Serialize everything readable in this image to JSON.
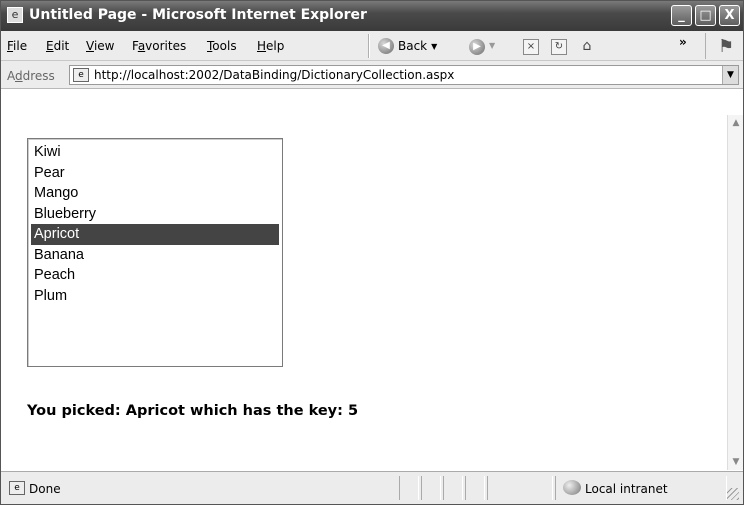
{
  "window": {
    "title": "Untitled Page - Microsoft Internet Explorer",
    "controls": {
      "minimize": "_",
      "maximize": "□",
      "close": "X"
    }
  },
  "menu": {
    "items": [
      {
        "label": "File",
        "accel": "F",
        "rest": "ile"
      },
      {
        "label": "Edit",
        "accel": "E",
        "rest": "dit"
      },
      {
        "label": "View",
        "accel": "V",
        "rest": "iew"
      },
      {
        "label": "Favorites",
        "pre": "F",
        "accel": "a",
        "rest": "vorites"
      },
      {
        "label": "Tools",
        "accel": "T",
        "rest": "ools"
      },
      {
        "label": "Help",
        "accel": "H",
        "rest": "elp"
      }
    ],
    "back_label": "Back",
    "more_chevron": "»"
  },
  "address": {
    "label_pre": "A",
    "label_accel": "d",
    "label_rest": "dress",
    "url": "http://localhost:2002/DataBinding/DictionaryCollection.aspx"
  },
  "listbox": {
    "options": [
      "Kiwi",
      "Pear",
      "Mango",
      "Blueberry",
      "Apricot",
      "Banana",
      "Peach",
      "Plum"
    ],
    "selected": "Apricot"
  },
  "result_text": "You picked: Apricot which has the key: 5",
  "status": {
    "text": "Done",
    "zone": "Local intranet"
  },
  "icons": {
    "titlebar": "ie-page-icon",
    "back": "back-arrow-icon",
    "forward": "forward-arrow-icon",
    "stop": "stop-icon",
    "refresh": "refresh-icon",
    "home": "home-icon",
    "page": "page-icon",
    "zone": "intranet-icon"
  }
}
